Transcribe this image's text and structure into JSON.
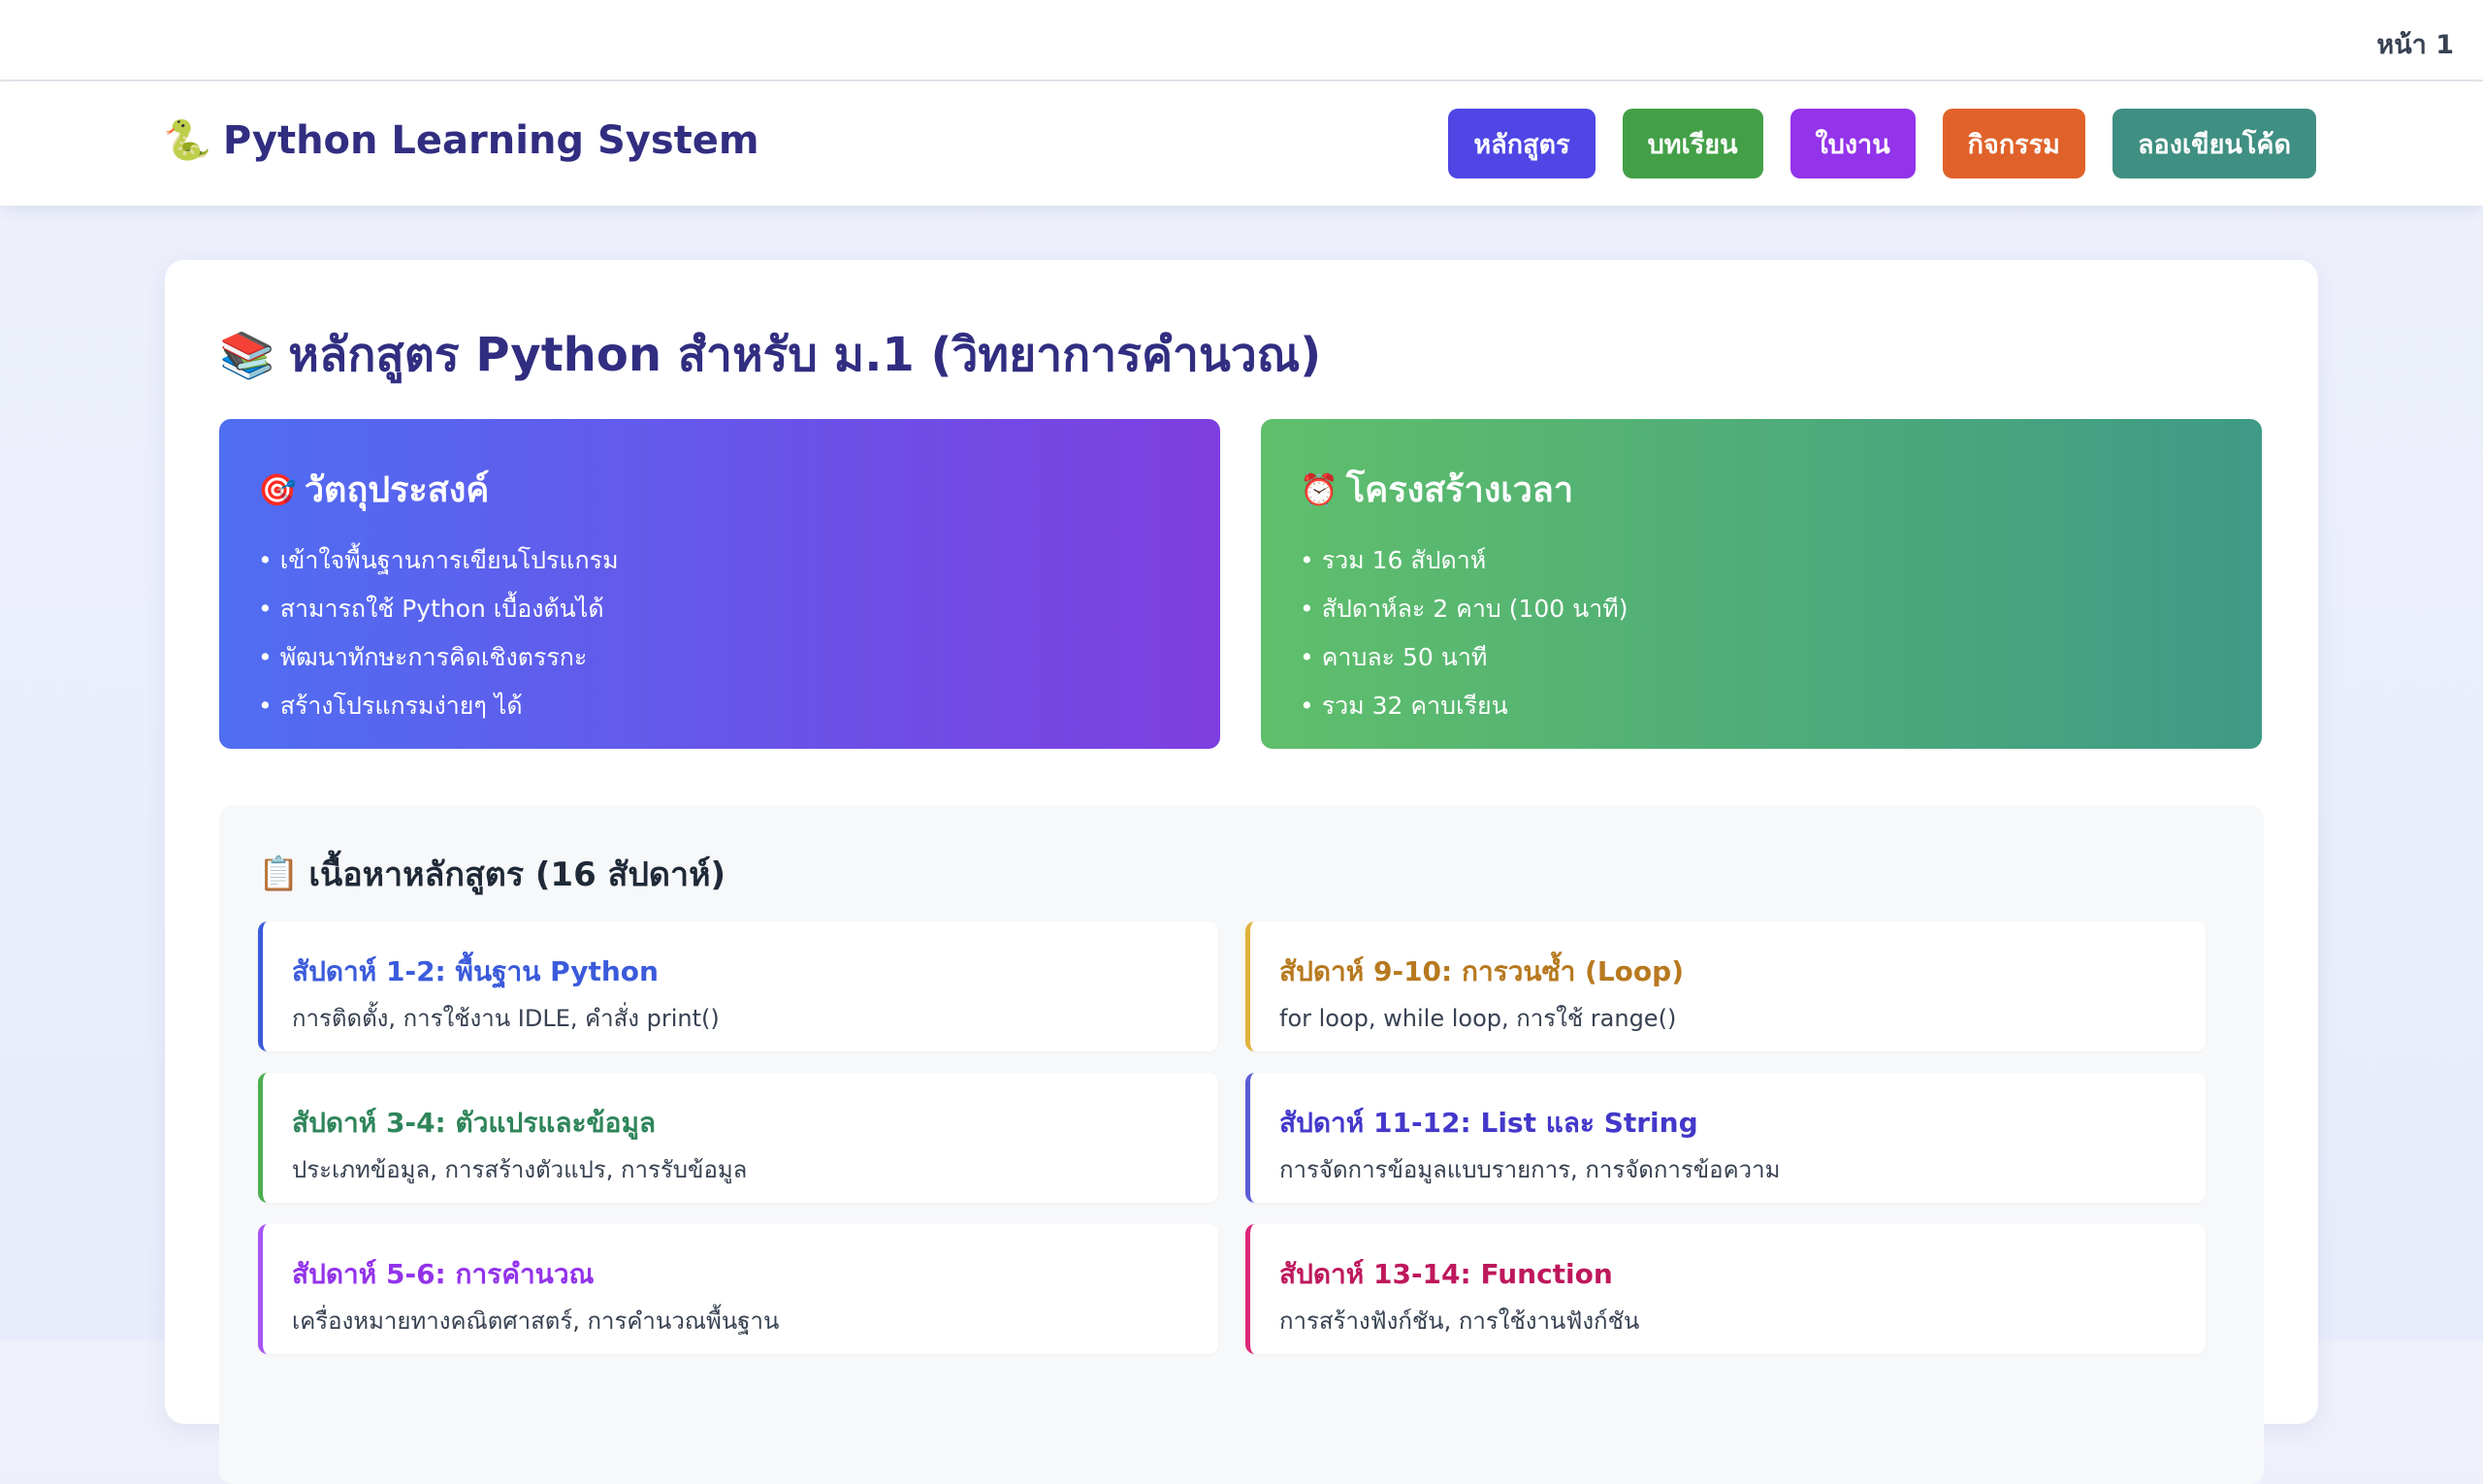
{
  "page_number": "หน้า 1",
  "navbar": {
    "brand_icon": "🐍",
    "brand_title": "Python Learning System",
    "buttons": [
      {
        "label": "หลักสูตร",
        "color": "#4f46e5"
      },
      {
        "label": "บทเรียน",
        "color": "#43a047"
      },
      {
        "label": "ใบงาน",
        "color": "#9333ea"
      },
      {
        "label": "กิจกรรม",
        "color": "#e0622a"
      },
      {
        "label": "ลองเขียนโค้ด",
        "color": "#3f8f82"
      }
    ]
  },
  "main": {
    "title_icon": "📚",
    "title": "หลักสูตร Python สำหรับ ม.1 (วิทยาการคำนวณ)",
    "objectives": {
      "icon": "🎯",
      "heading": "วัตถุประสงค์",
      "items": [
        "• เข้าใจพื้นฐานการเขียนโปรแกรม",
        "• สามารถใช้ Python เบื้องต้นได้",
        "• พัฒนาทักษะการคิดเชิงตรรกะ",
        "• สร้างโปรแกรมง่ายๆ ได้"
      ]
    },
    "time_structure": {
      "icon": "⏰",
      "heading": "โครงสร้างเวลา",
      "items": [
        "• รวม 16 สัปดาห์",
        "• สัปดาห์ละ 2 คาบ (100 นาที)",
        "• คาบละ 50 นาที",
        "• รวม 32 คาบเรียน"
      ]
    },
    "content": {
      "icon": "📋",
      "heading": "เนื้อหาหลักสูตร (16 สัปดาห์)",
      "weeks": [
        {
          "title": "สัปดาห์ 1-2: พื้นฐาน Python",
          "desc": "การติดตั้ง, การใช้งาน IDLE, คำสั่ง print()",
          "color": "#3b5bdb"
        },
        {
          "title": "สัปดาห์ 9-10: การวนซ้ำ (Loop)",
          "desc": "for loop, while loop, การใช้ range()",
          "color": "#b7791f",
          "border": "#e0b23a"
        },
        {
          "title": "สัปดาห์ 3-4: ตัวแปรและข้อมูล",
          "desc": "ประเภทข้อมูล, การสร้างตัวแปร, การรับข้อมูล",
          "color": "#2f855a",
          "border": "#4caf50"
        },
        {
          "title": "สัปดาห์ 11-12: List และ String",
          "desc": "การจัดการข้อมูลแบบรายการ, การจัดการข้อความ",
          "color": "#4338ca",
          "border": "#5b5bd6"
        },
        {
          "title": "สัปดาห์ 5-6: การคำนวณ",
          "desc": "เครื่องหมายทางคณิตศาสตร์, การคำนวณพื้นฐาน",
          "color": "#9333ea",
          "border": "#a855f7"
        },
        {
          "title": "สัปดาห์ 13-14: Function",
          "desc": "การสร้างฟังก์ชัน, การใช้งานฟังก์ชัน",
          "color": "#be185d",
          "border": "#db2777"
        }
      ]
    }
  }
}
